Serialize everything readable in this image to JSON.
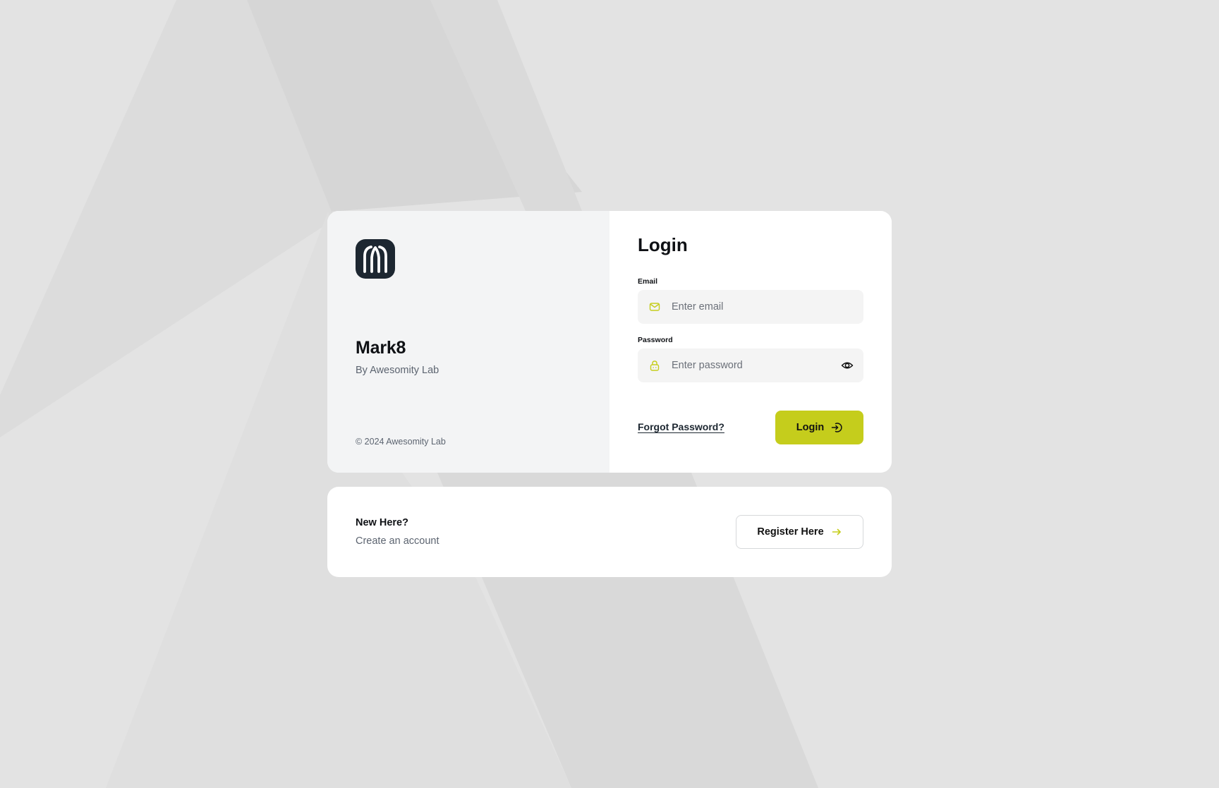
{
  "brand": {
    "name": "Mark8",
    "byline": "By Awesomity Lab",
    "copyright": "© 2024 Awesomity Lab"
  },
  "login": {
    "title": "Login",
    "email": {
      "label": "Email",
      "placeholder": "Enter email",
      "value": "",
      "icon": "mail-icon"
    },
    "password": {
      "label": "Password",
      "placeholder": "Enter password",
      "value": "",
      "icon": "lock-icon",
      "toggle_icon": "eye-icon"
    },
    "forgot_label": "Forgot Password?",
    "submit_label": "Login",
    "submit_icon": "login-arrow-icon"
  },
  "register": {
    "heading": "New Here?",
    "subtext": "Create an account",
    "button_label": "Register Here",
    "button_icon": "arrow-right-icon"
  },
  "colors": {
    "accent": "#c5cd1c",
    "logo_bg": "#1d2731",
    "page_bg": "#e3e3e3",
    "panel_bg": "#f3f4f5",
    "input_bg": "#f4f4f4",
    "muted_text": "#5c6470"
  }
}
